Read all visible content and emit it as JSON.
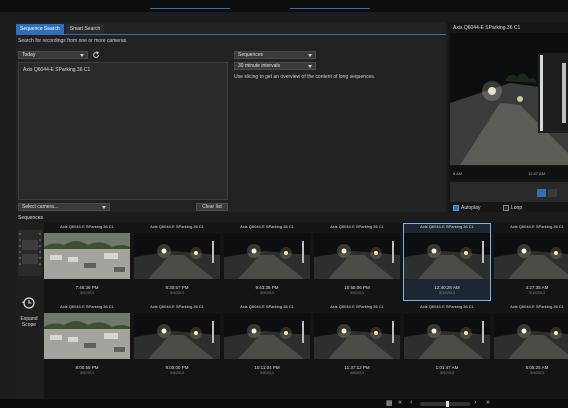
{
  "tabs": [
    {
      "label": "Sequence Search",
      "active": true
    },
    {
      "label": "Smart Search",
      "active": false
    }
  ],
  "search": {
    "hint": "Search for recordings from one or more cameras.",
    "period": "Today",
    "camera_list": [
      "Axis Q6044-E SParking.36 C1"
    ],
    "select_camera": "Select camera...",
    "clear_list": "Clear list",
    "mode": "Sequences",
    "interval": "30 minute intervals",
    "slicing_hint": "Use slicing to get an overview of the content of long sequences."
  },
  "preview": {
    "title": "Axis Q6044-E SParking.36 C1",
    "timeline_left": "8 AM",
    "timeline_right": "12:47 AM",
    "autoplay_label": "Autoplay",
    "autoplay_checked": true,
    "loop_label": "Loop",
    "loop_checked": false
  },
  "sequences": {
    "header": "Sequences",
    "expand_scope": "Expand Scope",
    "row1": [
      {
        "camera": "Axis Q6044-E SParking.36 C1",
        "time": "7:46:36 PM",
        "date": "5/9/2013",
        "scene": "day"
      },
      {
        "camera": "Axis Q6044-E SParking.36 C1",
        "time": "8:30:57 PM",
        "date": "5/9/2013",
        "scene": "night"
      },
      {
        "camera": "Axis Q6044-E SParking.36 C1",
        "time": "9:43:36 PM",
        "date": "5/9/2013",
        "scene": "night"
      },
      {
        "camera": "Axis Q6044-E SParking.36 C1",
        "time": "10:55:06 PM",
        "date": "5/9/2013",
        "scene": "night"
      },
      {
        "camera": "Axis Q6044-E SParking.36 C1",
        "time": "12:40:28 AM",
        "date": "5/10/2013",
        "scene": "night",
        "selected": true
      },
      {
        "camera": "Axis Q6044-E SParking.36 C1",
        "time": "4:27:35 AM",
        "date": "5/10/2013",
        "scene": "night"
      }
    ],
    "row2": [
      {
        "camera": "Axis Q6044-E SParking.36 C1",
        "time": "8:00:55 PM",
        "date": "5/8/2013",
        "scene": "day"
      },
      {
        "camera": "Axis Q6044-E SParking.36 C1",
        "time": "9:00:00 PM",
        "date": "5/8/2013",
        "scene": "night"
      },
      {
        "camera": "Axis Q6044-E SParking.36 C1",
        "time": "10:11:04 PM",
        "date": "5/8/2013",
        "scene": "night"
      },
      {
        "camera": "Axis Q6044-E SParking.36 C1",
        "time": "11:37:12 PM",
        "date": "5/8/2013",
        "scene": "night"
      },
      {
        "camera": "Axis Q6044-E SParking.36 C1",
        "time": "1:01:47 AM",
        "date": "5/9/2013",
        "scene": "night"
      },
      {
        "camera": "Axis Q6044-E SParking.36 C1",
        "time": "5:05:25 AM",
        "date": "5/9/2013",
        "scene": "night"
      }
    ]
  },
  "colors": {
    "accent": "#2f6fb3",
    "selection": "#79b4ec"
  }
}
